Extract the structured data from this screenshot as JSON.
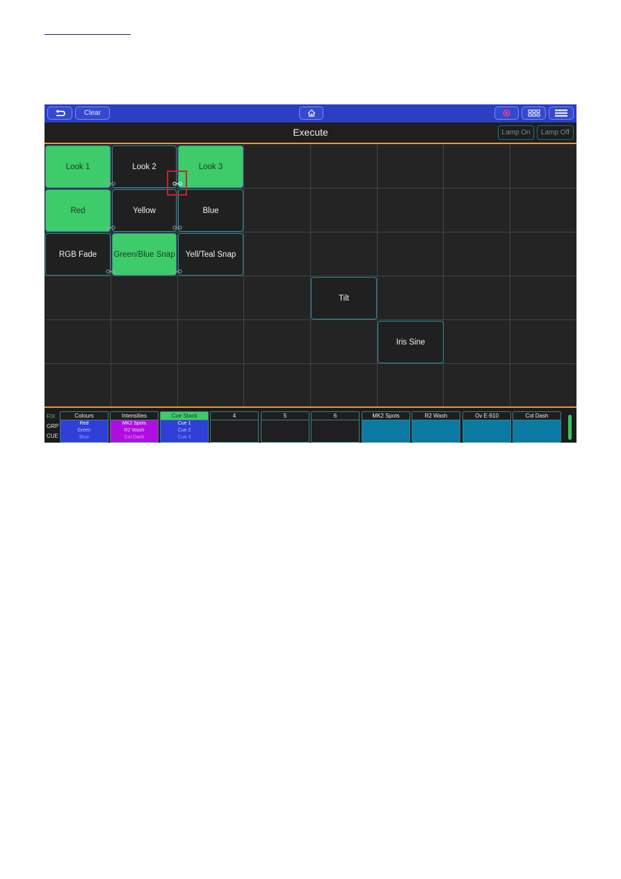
{
  "colors": {
    "topbar": "#2b3fc4",
    "active_tile": "#3ecb6a",
    "tile_border": "#2d8aa3",
    "accent_line": "#e69a3e",
    "highlight": "#c3272c"
  },
  "topbar": {
    "back_icon": "undo-arrow-icon",
    "clear_label": "Clear",
    "home_icon": "home-icon",
    "record_icon": "record-icon",
    "grid_icon": "grid-view-icon",
    "menu_icon": "hamburger-menu-icon"
  },
  "header": {
    "title": "Execute",
    "lamp_on": "Lamp On",
    "lamp_off": "Lamp Off"
  },
  "tiles": [
    {
      "label": "Look 1",
      "active": true
    },
    {
      "label": "Look 2",
      "active": false
    },
    {
      "label": "Look 3",
      "active": true
    },
    {
      "label": "Red",
      "active": true
    },
    {
      "label": "Yellow",
      "active": false
    },
    {
      "label": "Blue",
      "active": false
    },
    {
      "label": "RGB Fade",
      "active": false
    },
    {
      "label": "Green/Blue Snap",
      "active": true
    },
    {
      "label": "Yell/Teal Snap",
      "active": false
    },
    {
      "label": "Tilt",
      "active": false
    },
    {
      "label": "Iris Sine",
      "active": false
    }
  ],
  "modes": [
    "FIX",
    "GRP",
    "CUE"
  ],
  "palettes": [
    {
      "name": "Colours",
      "lines": [
        "Red",
        "Green",
        "Blue"
      ]
    },
    {
      "name": "Intensities",
      "lines": [
        "MK2 Spots",
        "R2 Wash",
        "Col Dash"
      ]
    },
    {
      "name": "Cue Stack",
      "lines": [
        "Cue 1",
        "Cue 2",
        "Cue 3"
      ]
    },
    {
      "name": "4",
      "lines": []
    },
    {
      "name": "5",
      "lines": []
    },
    {
      "name": "6",
      "lines": []
    },
    {
      "name": "MK2 Spots",
      "lines": []
    },
    {
      "name": "R2 Wash",
      "lines": []
    },
    {
      "name": "Ov E-910",
      "lines": []
    },
    {
      "name": "Col Dash",
      "lines": []
    }
  ]
}
